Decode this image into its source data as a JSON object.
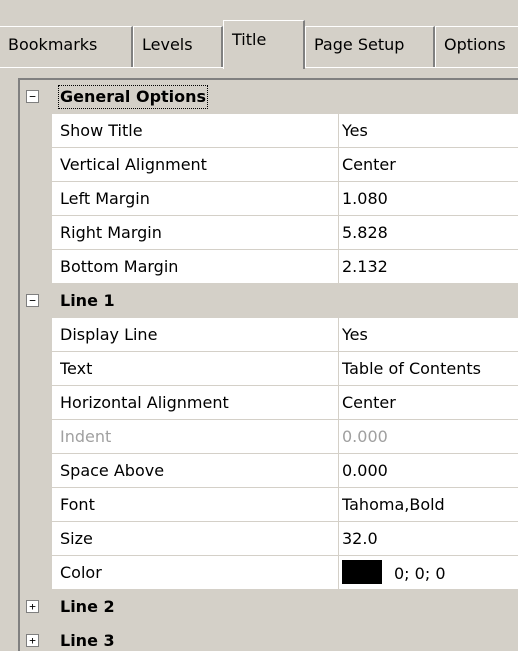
{
  "tabs": [
    {
      "label": "Bookmarks"
    },
    {
      "label": "Levels"
    },
    {
      "label": "Title",
      "active": true
    },
    {
      "label": "Page Setup"
    },
    {
      "label": "Options"
    }
  ],
  "categories": {
    "general": {
      "label": "General Options",
      "expanded": true,
      "toggle": "−"
    },
    "line1": {
      "label": "Line 1",
      "expanded": true,
      "toggle": "−"
    },
    "line2": {
      "label": "Line 2",
      "expanded": false,
      "toggle": "+"
    },
    "line3": {
      "label": "Line 3",
      "expanded": false,
      "toggle": "+"
    }
  },
  "general": {
    "show_title": {
      "name": "Show Title",
      "value": "Yes"
    },
    "vertical_alignment": {
      "name": "Vertical Alignment",
      "value": "Center"
    },
    "left_margin": {
      "name": "Left Margin",
      "value": "1.080"
    },
    "right_margin": {
      "name": "Right Margin",
      "value": "5.828"
    },
    "bottom_margin": {
      "name": "Bottom Margin",
      "value": "2.132"
    }
  },
  "line1": {
    "display_line": {
      "name": "Display Line",
      "value": "Yes"
    },
    "text": {
      "name": "Text",
      "value": "Table of Contents"
    },
    "horizontal_alignment": {
      "name": "Horizontal Alignment",
      "value": "Center"
    },
    "indent": {
      "name": "Indent",
      "value": "0.000",
      "disabled": true
    },
    "space_above": {
      "name": "Space Above",
      "value": "0.000"
    },
    "font": {
      "name": "Font",
      "value": "Tahoma,Bold"
    },
    "size": {
      "name": "Size",
      "value": "32.0"
    },
    "color": {
      "name": "Color",
      "value": "0; 0; 0",
      "swatch": "#000000"
    }
  },
  "colors": {
    "chrome": "#d4d0c8",
    "grid_bg": "#ffffff",
    "disabled_text": "#a0a0a0"
  }
}
